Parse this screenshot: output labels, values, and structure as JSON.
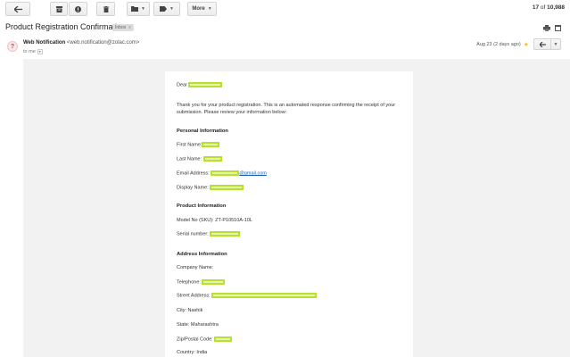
{
  "toolbar": {
    "more_label": "More",
    "count": {
      "current": "17",
      "of_label": "of",
      "total": "10,988"
    }
  },
  "message": {
    "subject": "Product Registration Confirmation",
    "label_badge": "Inbox",
    "label_close": "x",
    "sender_name": "Web Notification",
    "sender_email": "<web.notification@zolac.com>",
    "to_label": "to me",
    "date": "Aug 23 (2 days ago)"
  },
  "email": {
    "greeting": "Dear",
    "intro": "Thank you for your product registration. This is an automated response confirming the receipt of your submission. Please review your information below:",
    "personal": {
      "heading": "Personal Information",
      "first_name": "First Name:",
      "last_name": "Last Name:",
      "email_label": "Email Address:",
      "email_domain": "@gmail.com",
      "display_name": "Display Name:"
    },
    "product": {
      "heading": "Product Information",
      "model": "Model No (SKU): ZT-P10510A-10L",
      "serial": "Serial number:"
    },
    "address": {
      "heading": "Address Information",
      "company": "Company Name:",
      "telephone": "Telephone:",
      "street": "Street Address:",
      "city": "City: Nashik",
      "state": "State: Maharashtra",
      "zip": "Zip/Postal Code:",
      "country": "Country: India"
    }
  },
  "colors": {
    "redaction": "#b8e02e",
    "mail_bg": "#f2f2f2",
    "link": "#1a5fb4",
    "star": "#f5c518"
  }
}
